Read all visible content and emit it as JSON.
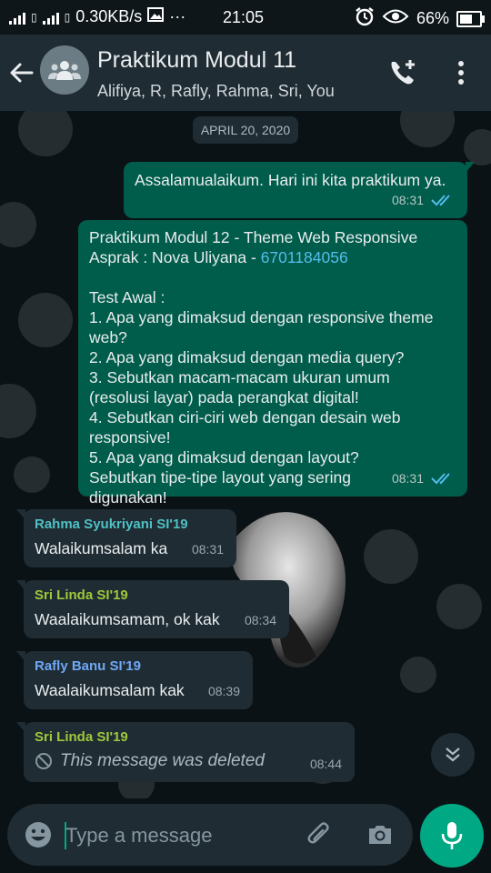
{
  "status_bar": {
    "net_speed": "0.30KB/s",
    "dots": "···",
    "time": "21:05",
    "battery": "66%",
    "battery_level": 0.66
  },
  "header": {
    "title": "Praktikum Modul 11",
    "participants": "Alifiya, R, Rafly, Rahma, Sri, You"
  },
  "chat": {
    "date_label": "APRIL 20, 2020",
    "messages": [
      {
        "text": "Assalamualaikum. Hari ini kita praktikum ya.",
        "time": "08:31"
      },
      {
        "line1": "Praktikum Modul 12 - Theme Web Responsive",
        "asprak_prefix": "Asprak : Nova Uliyana - ",
        "phone": "6701184056",
        "test_title": "Test Awal :",
        "q1": "1. Apa yang dimaksud dengan responsive theme web?",
        "q2": "2. Apa yang dimaksud dengan media query?",
        "q3": "3. Sebutkan macam-macam ukuran umum (resolusi layar) pada perangkat digital!",
        "q4": "4. Sebutkan ciri-ciri web dengan desain web responsive!",
        "q5": "5. Apa yang dimaksud dengan layout? Sebutkan tipe-tipe layout yang sering digunakan!",
        "time": "08:31"
      },
      {
        "sender": "Rahma Syukriyani SI'19",
        "sender_color": "#4fc1c4",
        "text": "Walaikumsalam ka",
        "time": "08:31"
      },
      {
        "sender": "Sri Linda SI'19",
        "sender_color": "#9fc93b",
        "text": "Waalaikumsamam, ok kak",
        "time": "08:34"
      },
      {
        "sender": "Rafly Banu SI'19",
        "sender_color": "#6fa8f5",
        "text": "Waalaikumsalam kak",
        "time": "08:39"
      },
      {
        "sender": "Sri Linda SI'19",
        "sender_color": "#9fc93b",
        "text": "This message was deleted",
        "time": "08:44"
      }
    ]
  },
  "composer": {
    "placeholder": "Type a message"
  },
  "icons": {
    "back": "arrow-left-icon",
    "group": "group-avatar-icon",
    "call": "add-call-icon",
    "menu": "more-vertical-icon",
    "emoji": "emoji-icon",
    "attach": "paperclip-icon",
    "camera": "camera-icon",
    "mic": "mic-icon",
    "scroll": "double-chevron-down-icon"
  },
  "colors": {
    "accent": "#00a884",
    "outgoing_bubble": "#005c4b",
    "incoming_bubble": "#1f2c33",
    "read_ticks": "#53bdeb"
  }
}
